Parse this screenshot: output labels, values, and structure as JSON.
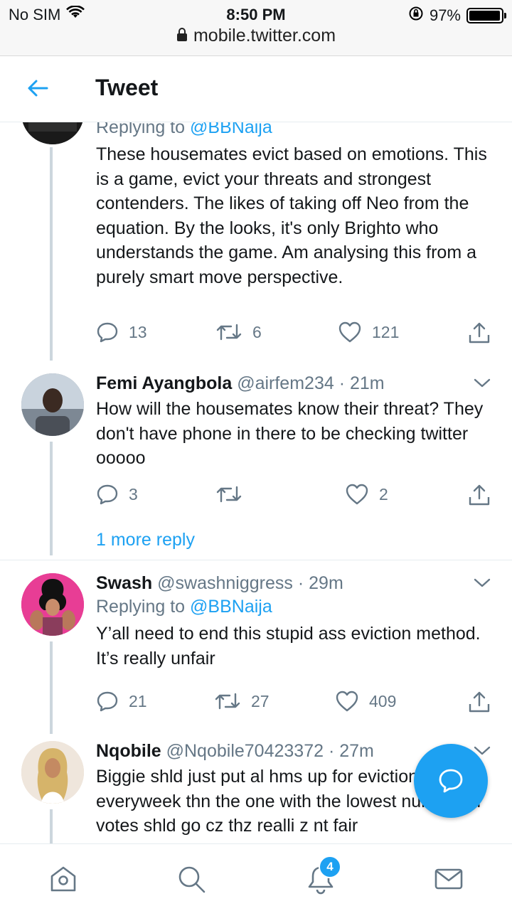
{
  "status_bar": {
    "carrier": "No SIM",
    "time": "8:50 PM",
    "battery": "97%",
    "battery_level": 0.97,
    "url": "mobile.twitter.com"
  },
  "header": {
    "title": "Tweet"
  },
  "tweets": [
    {
      "reply_prefix": "Replying to",
      "reply_to": "@BBNaija",
      "text": "These housemates evict based on emotions. This is a game, evict your threats and strongest contenders. The likes of taking off Neo from the equation. By the looks, it's only Brighto who understands the game. Am analysing this from a purely smart move perspective.",
      "replies": "13",
      "retweets": "6",
      "likes": "121"
    },
    {
      "name": "Femi Ayangbola",
      "handle": "@airfem234",
      "time": "21m",
      "text": "How will the housemates know their threat? They don't have phone in there to be checking twitter ooooo",
      "replies": "3",
      "retweets": "",
      "likes": "2"
    },
    {
      "name": "Swash",
      "handle": "@swashniggress",
      "time": "29m",
      "reply_prefix": "Replying to",
      "reply_to": "@BBNaija",
      "text": "Y’all need to end this stupid ass eviction method. It’s really unfair",
      "replies": "21",
      "retweets": "27",
      "likes": "409"
    },
    {
      "name": "Nqobile",
      "handle": "@Nqobile70423372",
      "time": "27m",
      "text": "Biggie shld just put al hms up for eviction everyweek thn the one with the lowest number of votes shld go cz thz realli z nt fair"
    }
  ],
  "more_replies": "1 more reply",
  "bottom_nav": {
    "notifications_badge": "4"
  },
  "colors": {
    "accent": "#1da1f2",
    "secondary_text": "#657786",
    "divider": "#e6ecf0"
  }
}
